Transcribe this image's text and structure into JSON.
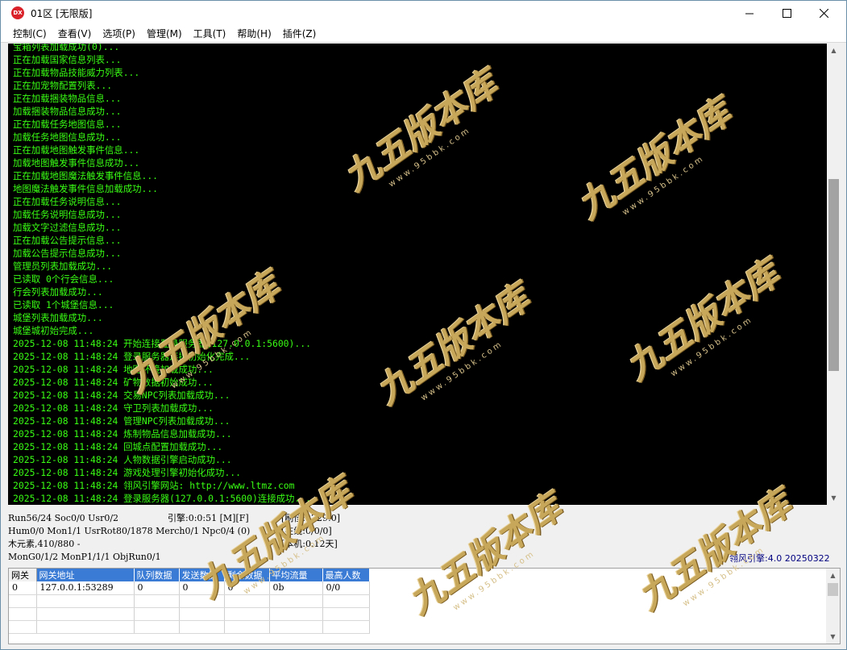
{
  "window": {
    "title": "01区 [无限版]",
    "app_icon": "DX",
    "controls": {
      "minimize": "—",
      "maximize": "☐",
      "close": "✕"
    }
  },
  "menu": [
    "控制(C)",
    "查看(V)",
    "选项(P)",
    "管理(M)",
    "工具(T)",
    "帮助(H)",
    "插件(Z)"
  ],
  "console": {
    "text_color": "#39ff14",
    "lines": [
      "宝箱列表加载成功(0)...",
      "正在加载国家信息列表...",
      "正在加载物品技能威力列表...",
      "正在加宠物配置列表...",
      "正在加载捆装物品信息...",
      "加载捆装物品信息成功...",
      "正在加载任务地图信息...",
      "加载任务地图信息成功...",
      "正在加载地图触发事件信息...",
      "加载地图触发事件信息成功...",
      "正在加载地图魔法触发事件信息...",
      "地图魔法触发事件信息加载成功...",
      "正在加载任务说明信息...",
      "加载任务说明信息成功...",
      "加载文字过滤信息成功...",
      "正在加载公告提示信息...",
      "加载公告提示信息成功...",
      "管理员列表加载成功...",
      "已读取 0个行会信息...",
      "行会列表加载成功...",
      "已读取 1个城堡信息...",
      "城堡列表加载成功...",
      "城堡城初始完成...",
      "2025-12-08 11:48:24 开始连接登录服务器(127.0.0.1:5600)...",
      "2025-12-08 11:48:24 登录服务器连接初始化完成...",
      "2025-12-08 11:48:24 地图环境加载成功...",
      "2025-12-08 11:48:24 矿物数据初始成功...",
      "2025-12-08 11:48:24 交易NPC列表加载成功...",
      "2025-12-08 11:48:24 守卫列表加载成功...",
      "2025-12-08 11:48:24 管理NPC列表加载成功...",
      "2025-12-08 11:48:24 炼制物品信息加载成功...",
      "2025-12-08 11:48:24 回城点配置加载成功...",
      "2025-12-08 11:48:24 人物数据引擎启动成功...",
      "2025-12-08 11:48:24 游戏处理引擎初始化成功...",
      "2025-12-08 11:48:24 翎风引擎网站: http://www.ltmz.com",
      "2025-12-08 11:48:24 登录服务器(127.0.0.1:5600)连接成功..."
    ]
  },
  "status": {
    "run": "Run56/24 Soc0/0 Usr0/2",
    "engine": "引擎:0:0:51 [M][F]",
    "refresh": "[刷怪:2729:0]",
    "hum": "Hum0/0 Mon1/1 UsrRot80/1878 Merch0/1 Npc0/4 (0)",
    "online": "[在线:0/0/0]",
    "element": "木元素,410/880 -",
    "local": "[本机:0.12天]",
    "mon": "MonG0/1/2 MonP1/1/1 ObjRun0/1",
    "version": "翎风引擎:4.0 20250322"
  },
  "grid": {
    "columns": [
      "网关",
      "网关地址",
      "队列数据",
      "发送数据",
      "剩余数据",
      "平均流量",
      "最高人数"
    ],
    "rows": [
      [
        "0",
        "127.0.0.1:53289",
        "0",
        "0",
        "0",
        "0b",
        "0/0"
      ],
      [
        "",
        "",
        "",
        "",
        "",
        "",
        ""
      ],
      [
        "",
        "",
        "",
        "",
        "",
        "",
        ""
      ],
      [
        "",
        "",
        "",
        "",
        "",
        "",
        ""
      ]
    ]
  },
  "watermark": {
    "logo": "九五版本库",
    "url": "www.95bbk.com"
  }
}
